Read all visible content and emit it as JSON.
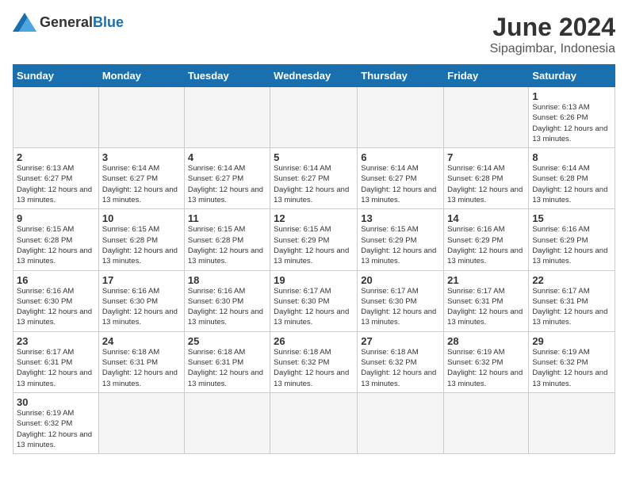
{
  "logo": {
    "text_general": "General",
    "text_blue": "Blue"
  },
  "calendar": {
    "title": "June 2024",
    "subtitle": "Sipagimbar, Indonesia",
    "days_of_week": [
      "Sunday",
      "Monday",
      "Tuesday",
      "Wednesday",
      "Thursday",
      "Friday",
      "Saturday"
    ],
    "weeks": [
      [
        {
          "day": "",
          "info": ""
        },
        {
          "day": "",
          "info": ""
        },
        {
          "day": "",
          "info": ""
        },
        {
          "day": "",
          "info": ""
        },
        {
          "day": "",
          "info": ""
        },
        {
          "day": "",
          "info": ""
        },
        {
          "day": "1",
          "info": "Sunrise: 6:13 AM\nSunset: 6:26 PM\nDaylight: 12 hours and 13 minutes."
        }
      ],
      [
        {
          "day": "2",
          "info": "Sunrise: 6:13 AM\nSunset: 6:27 PM\nDaylight: 12 hours and 13 minutes."
        },
        {
          "day": "3",
          "info": "Sunrise: 6:14 AM\nSunset: 6:27 PM\nDaylight: 12 hours and 13 minutes."
        },
        {
          "day": "4",
          "info": "Sunrise: 6:14 AM\nSunset: 6:27 PM\nDaylight: 12 hours and 13 minutes."
        },
        {
          "day": "5",
          "info": "Sunrise: 6:14 AM\nSunset: 6:27 PM\nDaylight: 12 hours and 13 minutes."
        },
        {
          "day": "6",
          "info": "Sunrise: 6:14 AM\nSunset: 6:27 PM\nDaylight: 12 hours and 13 minutes."
        },
        {
          "day": "7",
          "info": "Sunrise: 6:14 AM\nSunset: 6:28 PM\nDaylight: 12 hours and 13 minutes."
        },
        {
          "day": "8",
          "info": "Sunrise: 6:14 AM\nSunset: 6:28 PM\nDaylight: 12 hours and 13 minutes."
        }
      ],
      [
        {
          "day": "9",
          "info": "Sunrise: 6:15 AM\nSunset: 6:28 PM\nDaylight: 12 hours and 13 minutes."
        },
        {
          "day": "10",
          "info": "Sunrise: 6:15 AM\nSunset: 6:28 PM\nDaylight: 12 hours and 13 minutes."
        },
        {
          "day": "11",
          "info": "Sunrise: 6:15 AM\nSunset: 6:28 PM\nDaylight: 12 hours and 13 minutes."
        },
        {
          "day": "12",
          "info": "Sunrise: 6:15 AM\nSunset: 6:29 PM\nDaylight: 12 hours and 13 minutes."
        },
        {
          "day": "13",
          "info": "Sunrise: 6:15 AM\nSunset: 6:29 PM\nDaylight: 12 hours and 13 minutes."
        },
        {
          "day": "14",
          "info": "Sunrise: 6:16 AM\nSunset: 6:29 PM\nDaylight: 12 hours and 13 minutes."
        },
        {
          "day": "15",
          "info": "Sunrise: 6:16 AM\nSunset: 6:29 PM\nDaylight: 12 hours and 13 minutes."
        }
      ],
      [
        {
          "day": "16",
          "info": "Sunrise: 6:16 AM\nSunset: 6:30 PM\nDaylight: 12 hours and 13 minutes."
        },
        {
          "day": "17",
          "info": "Sunrise: 6:16 AM\nSunset: 6:30 PM\nDaylight: 12 hours and 13 minutes."
        },
        {
          "day": "18",
          "info": "Sunrise: 6:16 AM\nSunset: 6:30 PM\nDaylight: 12 hours and 13 minutes."
        },
        {
          "day": "19",
          "info": "Sunrise: 6:17 AM\nSunset: 6:30 PM\nDaylight: 12 hours and 13 minutes."
        },
        {
          "day": "20",
          "info": "Sunrise: 6:17 AM\nSunset: 6:30 PM\nDaylight: 12 hours and 13 minutes."
        },
        {
          "day": "21",
          "info": "Sunrise: 6:17 AM\nSunset: 6:31 PM\nDaylight: 12 hours and 13 minutes."
        },
        {
          "day": "22",
          "info": "Sunrise: 6:17 AM\nSunset: 6:31 PM\nDaylight: 12 hours and 13 minutes."
        }
      ],
      [
        {
          "day": "23",
          "info": "Sunrise: 6:17 AM\nSunset: 6:31 PM\nDaylight: 12 hours and 13 minutes."
        },
        {
          "day": "24",
          "info": "Sunrise: 6:18 AM\nSunset: 6:31 PM\nDaylight: 12 hours and 13 minutes."
        },
        {
          "day": "25",
          "info": "Sunrise: 6:18 AM\nSunset: 6:31 PM\nDaylight: 12 hours and 13 minutes."
        },
        {
          "day": "26",
          "info": "Sunrise: 6:18 AM\nSunset: 6:32 PM\nDaylight: 12 hours and 13 minutes."
        },
        {
          "day": "27",
          "info": "Sunrise: 6:18 AM\nSunset: 6:32 PM\nDaylight: 12 hours and 13 minutes."
        },
        {
          "day": "28",
          "info": "Sunrise: 6:19 AM\nSunset: 6:32 PM\nDaylight: 12 hours and 13 minutes."
        },
        {
          "day": "29",
          "info": "Sunrise: 6:19 AM\nSunset: 6:32 PM\nDaylight: 12 hours and 13 minutes."
        }
      ],
      [
        {
          "day": "30",
          "info": "Sunrise: 6:19 AM\nSunset: 6:32 PM\nDaylight: 12 hours and 13 minutes."
        },
        {
          "day": "",
          "info": ""
        },
        {
          "day": "",
          "info": ""
        },
        {
          "day": "",
          "info": ""
        },
        {
          "day": "",
          "info": ""
        },
        {
          "day": "",
          "info": ""
        },
        {
          "day": "",
          "info": ""
        }
      ]
    ]
  }
}
